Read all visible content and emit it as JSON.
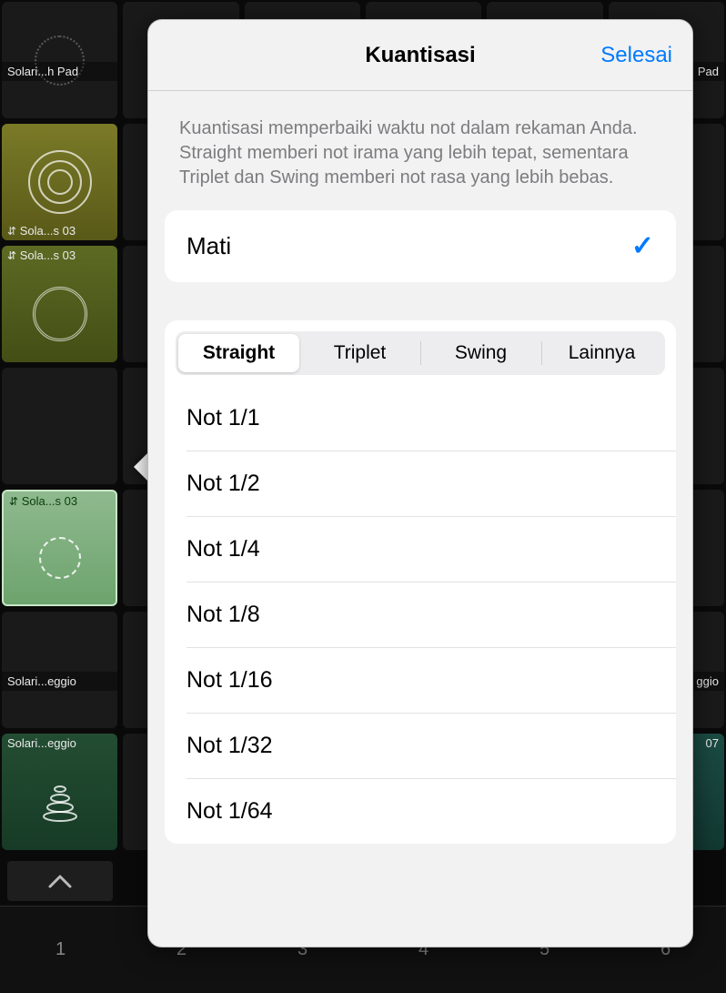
{
  "bg": {
    "cells": {
      "r1_yellow_label": "Solari...h Pad",
      "r1_right_label": "Pad",
      "r2_olive_label": "Sola...s 03",
      "r4_green_label": "Sola...s 03",
      "r6_left_label": "Solari...eggio",
      "r6_right_label": "ggio",
      "r7_right_label": "07"
    }
  },
  "bottom_nums": [
    "1",
    "2",
    "3",
    "4",
    "5",
    "6"
  ],
  "popover": {
    "title": "Kuantisasi",
    "done": "Selesai",
    "desc": "Kuantisasi memperbaiki waktu not dalam rekaman Anda. Straight memberi not irama yang lebih tepat, sementara Triplet dan Swing memberi not rasa yang lebih bebas.",
    "off_label": "Mati",
    "tabs": [
      "Straight",
      "Triplet",
      "Swing",
      "Lainnya"
    ],
    "active_tab": 0,
    "notes": [
      "Not 1/1",
      "Not 1/2",
      "Not 1/4",
      "Not 1/8",
      "Not 1/16",
      "Not 1/32",
      "Not 1/64"
    ]
  }
}
